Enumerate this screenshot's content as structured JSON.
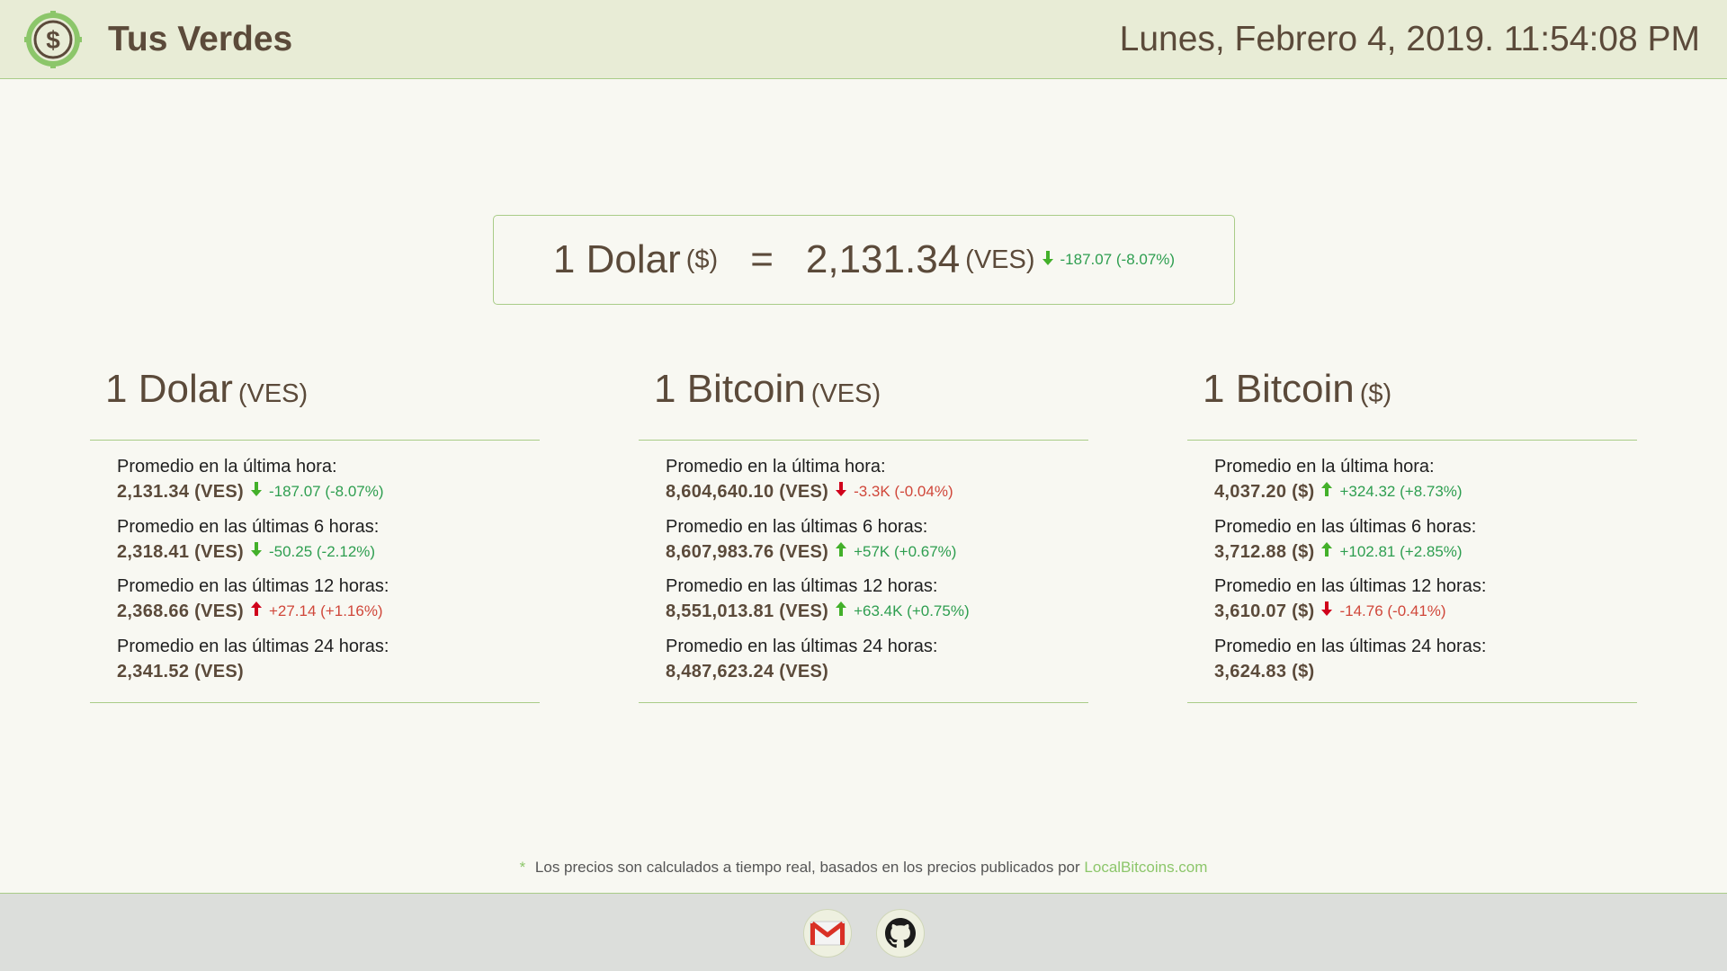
{
  "header": {
    "brand": "Tus Verdes",
    "datetime": "Lunes, Febrero 4, 2019. 11:54:08 PM",
    "logo_icon": "dollar-coin-icon"
  },
  "main_rate": {
    "left_amount": "1 Dolar",
    "left_unit": "($)",
    "equals": "=",
    "value": "2,131.34",
    "unit": "(VES)",
    "change": "-187.07 (-8.07%)",
    "direction": "down"
  },
  "cards": [
    {
      "title": "1 Dolar",
      "unit": "(VES)",
      "stats": [
        {
          "label": "Promedio en la última hora:",
          "value": "2,131.34 (VES)",
          "change": "-187.07 (-8.07%)",
          "direction": "down"
        },
        {
          "label": "Promedio en las últimas 6 horas:",
          "value": "2,318.41 (VES)",
          "change": "-50.25 (-2.12%)",
          "direction": "down"
        },
        {
          "label": "Promedio en las últimas 12 horas:",
          "value": "2,368.66 (VES)",
          "change": "+27.14 (+1.16%)",
          "direction": "up"
        },
        {
          "label": "Promedio en las últimas 24 horas:",
          "value": "2,341.52 (VES)",
          "change": "",
          "direction": ""
        }
      ]
    },
    {
      "title": "1 Bitcoin",
      "unit": "(VES)",
      "stats": [
        {
          "label": "Promedio en la última hora:",
          "value": "8,604,640.10 (VES)",
          "change": "-3.3K (-0.04%)",
          "direction": "down-red"
        },
        {
          "label": "Promedio en las últimas 6 horas:",
          "value": "8,607,983.76 (VES)",
          "change": "+57K (+0.67%)",
          "direction": "up-green"
        },
        {
          "label": "Promedio en las últimas 12 horas:",
          "value": "8,551,013.81 (VES)",
          "change": "+63.4K (+0.75%)",
          "direction": "up-green"
        },
        {
          "label": "Promedio en las últimas 24 horas:",
          "value": "8,487,623.24 (VES)",
          "change": "",
          "direction": ""
        }
      ]
    },
    {
      "title": "1 Bitcoin",
      "unit": "($)",
      "stats": [
        {
          "label": "Promedio en la última hora:",
          "value": "4,037.20 ($)",
          "change": "+324.32 (+8.73%)",
          "direction": "up-green"
        },
        {
          "label": "Promedio en las últimas 6 horas:",
          "value": "3,712.88 ($)",
          "change": "+102.81 (+2.85%)",
          "direction": "up-green"
        },
        {
          "label": "Promedio en las últimas 12 horas:",
          "value": "3,610.07 ($)",
          "change": "-14.76 (-0.41%)",
          "direction": "down-red"
        },
        {
          "label": "Promedio en las últimas 24 horas:",
          "value": "3,624.83 ($)",
          "change": "",
          "direction": ""
        }
      ]
    }
  ],
  "footer": {
    "note_star": "*",
    "note_text": "Los precios son calculados a tiempo real, basados en los precios publicados por",
    "note_link": "LocalBitcoins.com",
    "mail_icon": "gmail-icon",
    "github_icon": "github-icon"
  },
  "colors": {
    "green": "#2e9e50",
    "red": "#d0473a",
    "arrow_green": "#43b02a",
    "arrow_red": "#d0021b",
    "accent": "#a9cc88",
    "text": "#5b4a3a"
  }
}
